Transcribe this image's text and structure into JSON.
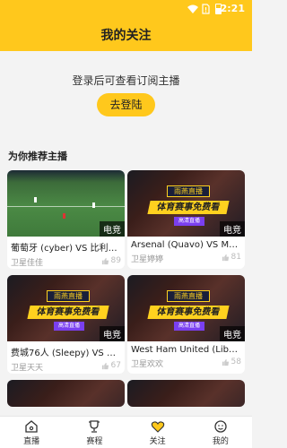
{
  "status": {
    "time": "2:21"
  },
  "header": {
    "title": "我的关注"
  },
  "login": {
    "prompt": "登录后可查看订阅主播",
    "button": "去登陆"
  },
  "section": {
    "title": "为你推荐主播"
  },
  "cards": [
    {
      "name": "葡萄牙 (cyber) VS 比利时 (…",
      "anchor": "卫星佳佳",
      "likes": "89",
      "tag": "电竞",
      "thumb": "pitch"
    },
    {
      "name": "Arsenal (Quavo) VS Manc…",
      "anchor": "卫星婷婷",
      "likes": "81",
      "tag": "电竞",
      "thumb": "promo"
    },
    {
      "name": "费城76人 (Sleepy) VS Bro…",
      "anchor": "卫星天天",
      "likes": "67",
      "tag": "电竞",
      "thumb": "promo"
    },
    {
      "name": "West Ham United (Libra) …",
      "anchor": "卫星欢欢",
      "likes": "58",
      "tag": "电竞",
      "thumb": "promo"
    }
  ],
  "promo": {
    "brand": "雨燕直播",
    "slogan": "体育赛事免费看",
    "sub": "高清直播"
  },
  "tabs": [
    {
      "label": "直播",
      "icon": "home-icon"
    },
    {
      "label": "赛程",
      "icon": "trophy-icon"
    },
    {
      "label": "关注",
      "icon": "heart-icon"
    },
    {
      "label": "我的",
      "icon": "smile-icon"
    }
  ],
  "colors": {
    "accent": "#ffc81c"
  }
}
